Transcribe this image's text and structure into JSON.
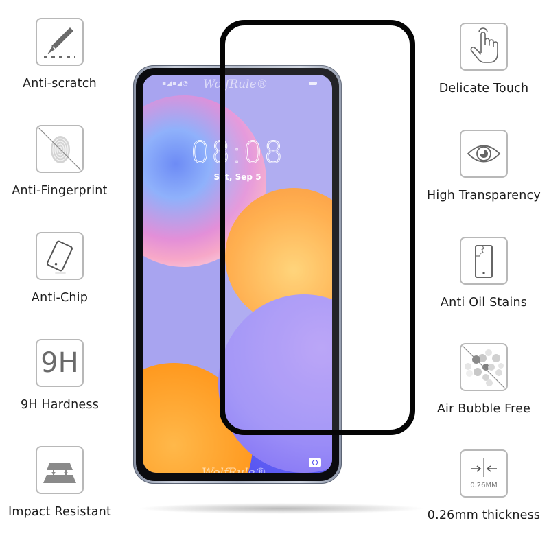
{
  "features_left": [
    {
      "label": "Anti-scratch",
      "icon": "scalpel-icon"
    },
    {
      "label": "Anti-Fingerprint",
      "icon": "fingerprint-crossed-icon"
    },
    {
      "label": "Anti-Chip",
      "icon": "phone-tilted-icon"
    },
    {
      "label": "9H Hardness",
      "icon": "9h-icon",
      "icon_text": "9H"
    },
    {
      "label": "Impact Resistant",
      "icon": "layers-impact-icon"
    }
  ],
  "features_right": [
    {
      "label": "Delicate Touch",
      "icon": "hand-touch-icon"
    },
    {
      "label": "High Transparency",
      "icon": "eye-icon"
    },
    {
      "label": "Anti Oil Stains",
      "icon": "phone-cracked-icon"
    },
    {
      "label": "Air Bubble Free",
      "icon": "bubbles-crossed-icon"
    },
    {
      "label": "0.26mm thickness",
      "icon": "thickness-arrows-icon",
      "icon_text": "0.26MM"
    }
  ],
  "phone": {
    "time": "08:08",
    "date": "Sat, Sep 5",
    "watermark": "WolfRule®",
    "status_icons": "▪◢▪◢◔"
  },
  "colors": {
    "protector_border": "#050505",
    "icon_gray": "#6a6a6a",
    "icon_border": "#b8b8b8",
    "label_text": "#1c1c1c"
  }
}
